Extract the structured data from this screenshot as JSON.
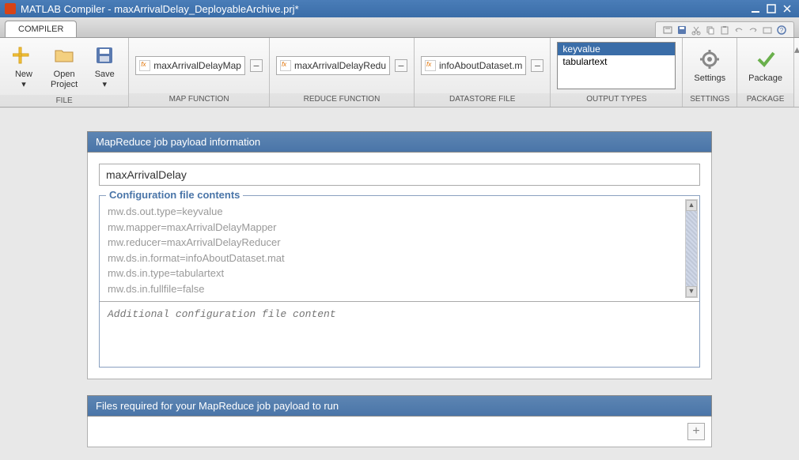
{
  "titlebar": {
    "app": "MATLAB Compiler",
    "file": "maxArrivalDelay_DeployableArchive.prj*"
  },
  "tab": {
    "compiler": "COMPILER"
  },
  "ribbon": {
    "file": {
      "new": "New",
      "open": "Open\nProject",
      "save": "Save",
      "label": "FILE"
    },
    "map": {
      "file": "maxArrivalDelayMap",
      "label": "MAP FUNCTION"
    },
    "reduce": {
      "file": "maxArrivalDelayRedu",
      "label": "REDUCE FUNCTION"
    },
    "datastore": {
      "file": "infoAboutDataset.m",
      "label": "DATASTORE FILE"
    },
    "output": {
      "opt1": "keyvalue",
      "opt2": "tabulartext",
      "label": "OUTPUT TYPES"
    },
    "settings": {
      "btn": "Settings",
      "label": "SETTINGS"
    },
    "package": {
      "btn": "Package",
      "label": "PACKAGE"
    }
  },
  "payload": {
    "header": "MapReduce job payload information",
    "name": "maxArrivalDelay",
    "config_legend": "Configuration file contents",
    "config_lines": "mw.ds.out.type=keyvalue\nmw.mapper=maxArrivalDelayMapper\nmw.reducer=maxArrivalDelayReducer\nmw.ds.in.format=infoAboutDataset.mat\nmw.ds.in.type=tabulartext\nmw.ds.in.fullfile=false",
    "additional_placeholder": "Additional configuration file content"
  },
  "files": {
    "header": "Files required for your MapReduce job payload to run"
  }
}
